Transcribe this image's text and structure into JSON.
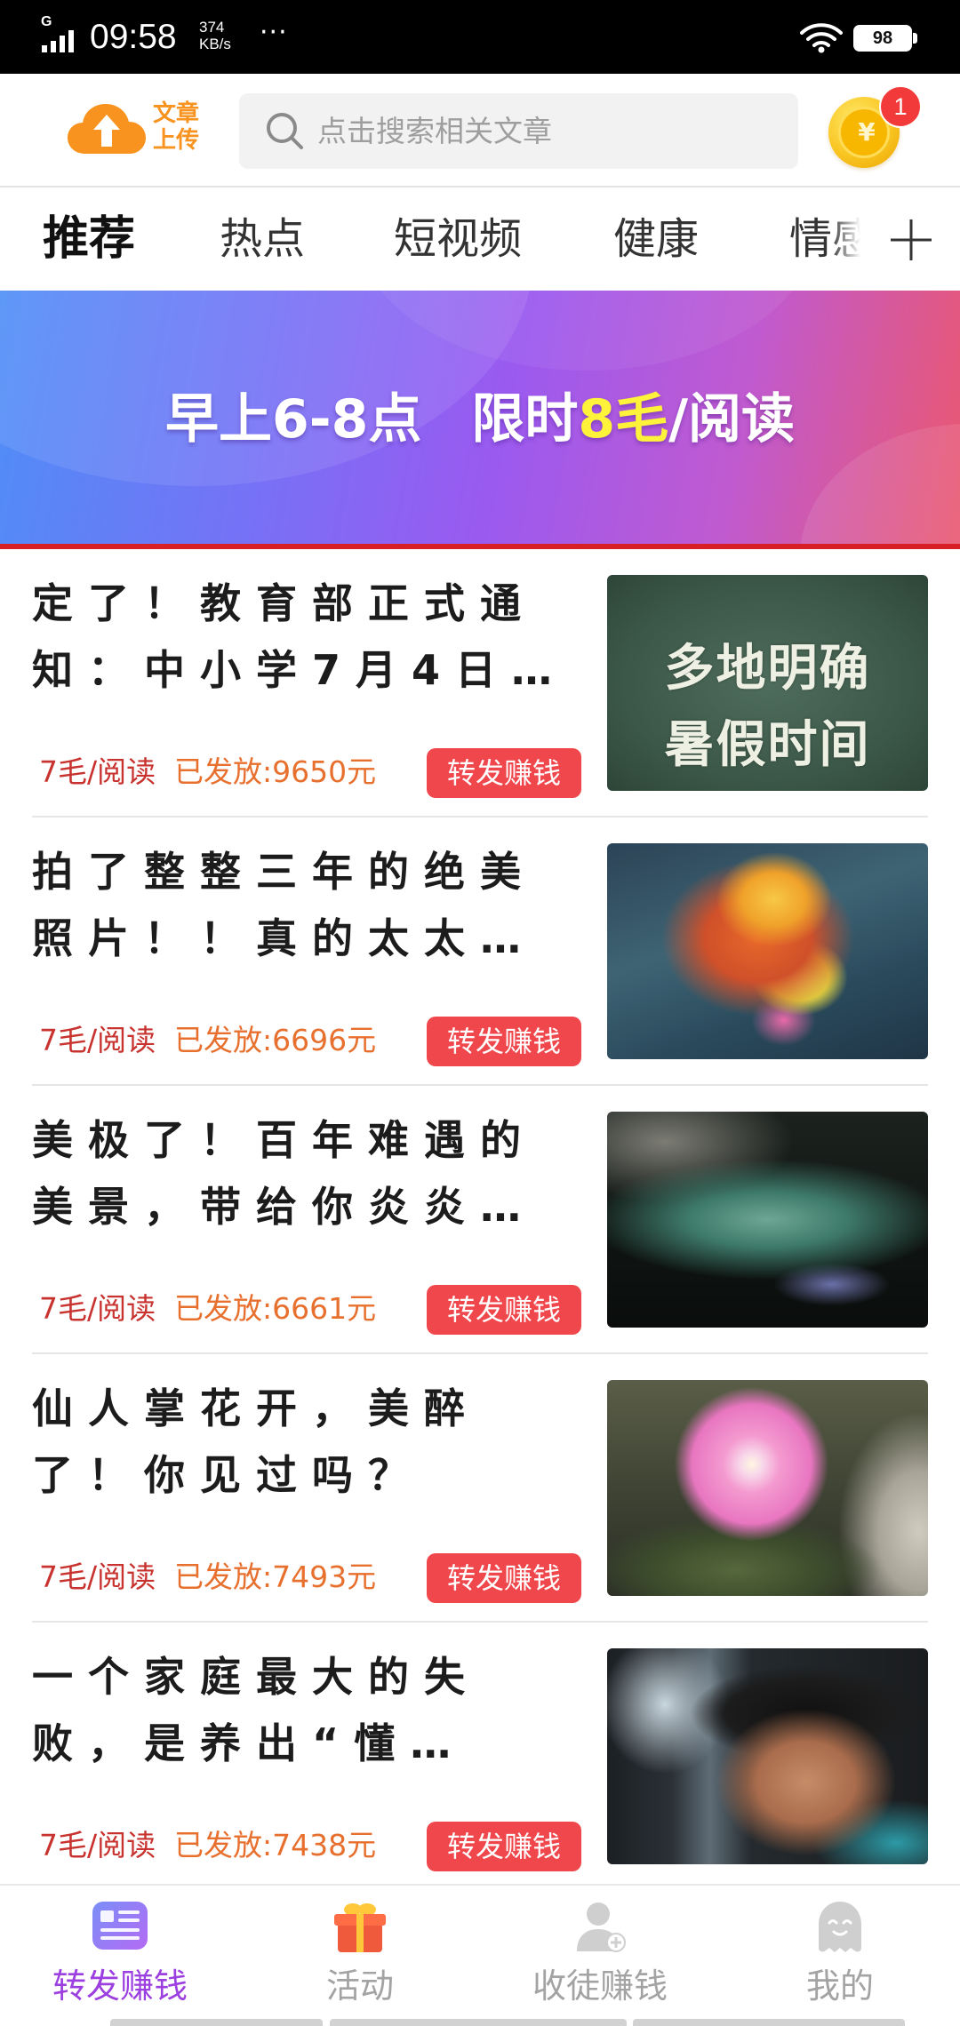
{
  "status_bar": {
    "network_type": "G",
    "time": "09:58",
    "speed_value": "374",
    "speed_unit": "KB/s",
    "more": "···",
    "battery": "98",
    "icons": [
      "signal-icon",
      "wifi-icon",
      "battery-icon"
    ]
  },
  "header": {
    "logo_icon": "cloud-upload-icon",
    "logo_line1": "文章",
    "logo_line2": "上传",
    "search_icon": "search-icon",
    "search_placeholder": "点击搜索相关文章",
    "coin_icon": "gold-coin-icon",
    "coin_symbol": "¥",
    "coin_badge": "1"
  },
  "tabs": {
    "items": [
      {
        "label": "推荐",
        "active": true
      },
      {
        "label": "热点",
        "active": false
      },
      {
        "label": "短视频",
        "active": false
      },
      {
        "label": "健康",
        "active": false
      },
      {
        "label": "情感",
        "active": false
      }
    ],
    "add_icon": "plus-icon"
  },
  "banner": {
    "text_part1": "早上6-8点",
    "text_part2": "限时",
    "text_highlight": "8毛",
    "text_part3": "/阅读"
  },
  "articles": [
    {
      "title_lines": [
        "定了！教育部正式通",
        "知：中小学7月4日…"
      ],
      "rate": "7毛/阅读",
      "paid": "已发放:9650元",
      "share_label": "转发赚钱",
      "thumb_text": [
        "多地明确",
        "暑假时间"
      ]
    },
    {
      "title_lines": [
        "拍了整整三年的绝美",
        "照片！！真的太太…"
      ],
      "rate": "7毛/阅读",
      "paid": "已发放:6696元",
      "share_label": "转发赚钱"
    },
    {
      "title_lines": [
        "美极了！百年难遇的",
        "美景，带给你炎炎…"
      ],
      "rate": "7毛/阅读",
      "paid": "已发放:6661元",
      "share_label": "转发赚钱"
    },
    {
      "title_lines": [
        "仙人掌花开，美醉",
        "了！你见过吗？"
      ],
      "rate": "7毛/阅读",
      "paid": "已发放:7493元",
      "share_label": "转发赚钱"
    },
    {
      "title_lines": [
        "一个家庭最大的失",
        "败，是养出“懂…"
      ],
      "rate": "7毛/阅读",
      "paid": "已发放:7438元",
      "share_label": "转发赚钱"
    }
  ],
  "bottom_nav": [
    {
      "label": "转发赚钱",
      "icon": "article-card-icon",
      "active": true
    },
    {
      "label": "活动",
      "icon": "gift-icon",
      "active": false
    },
    {
      "label": "收徒赚钱",
      "icon": "add-follower-icon",
      "active": false
    },
    {
      "label": "我的",
      "icon": "profile-face-icon",
      "active": false
    }
  ],
  "colors": {
    "status_bar_bg": "#000000",
    "accent_orange": "#f7931e",
    "rate_red": "#c8332f",
    "paid_orange": "#e8702f",
    "share_button_red": "#f0474c",
    "nav_active_purple": "#9c3fe0",
    "nav_inactive_gray": "#a3a3a3",
    "banner_highlight_yellow": "#fff23a",
    "badge_red": "#f23a3a"
  }
}
